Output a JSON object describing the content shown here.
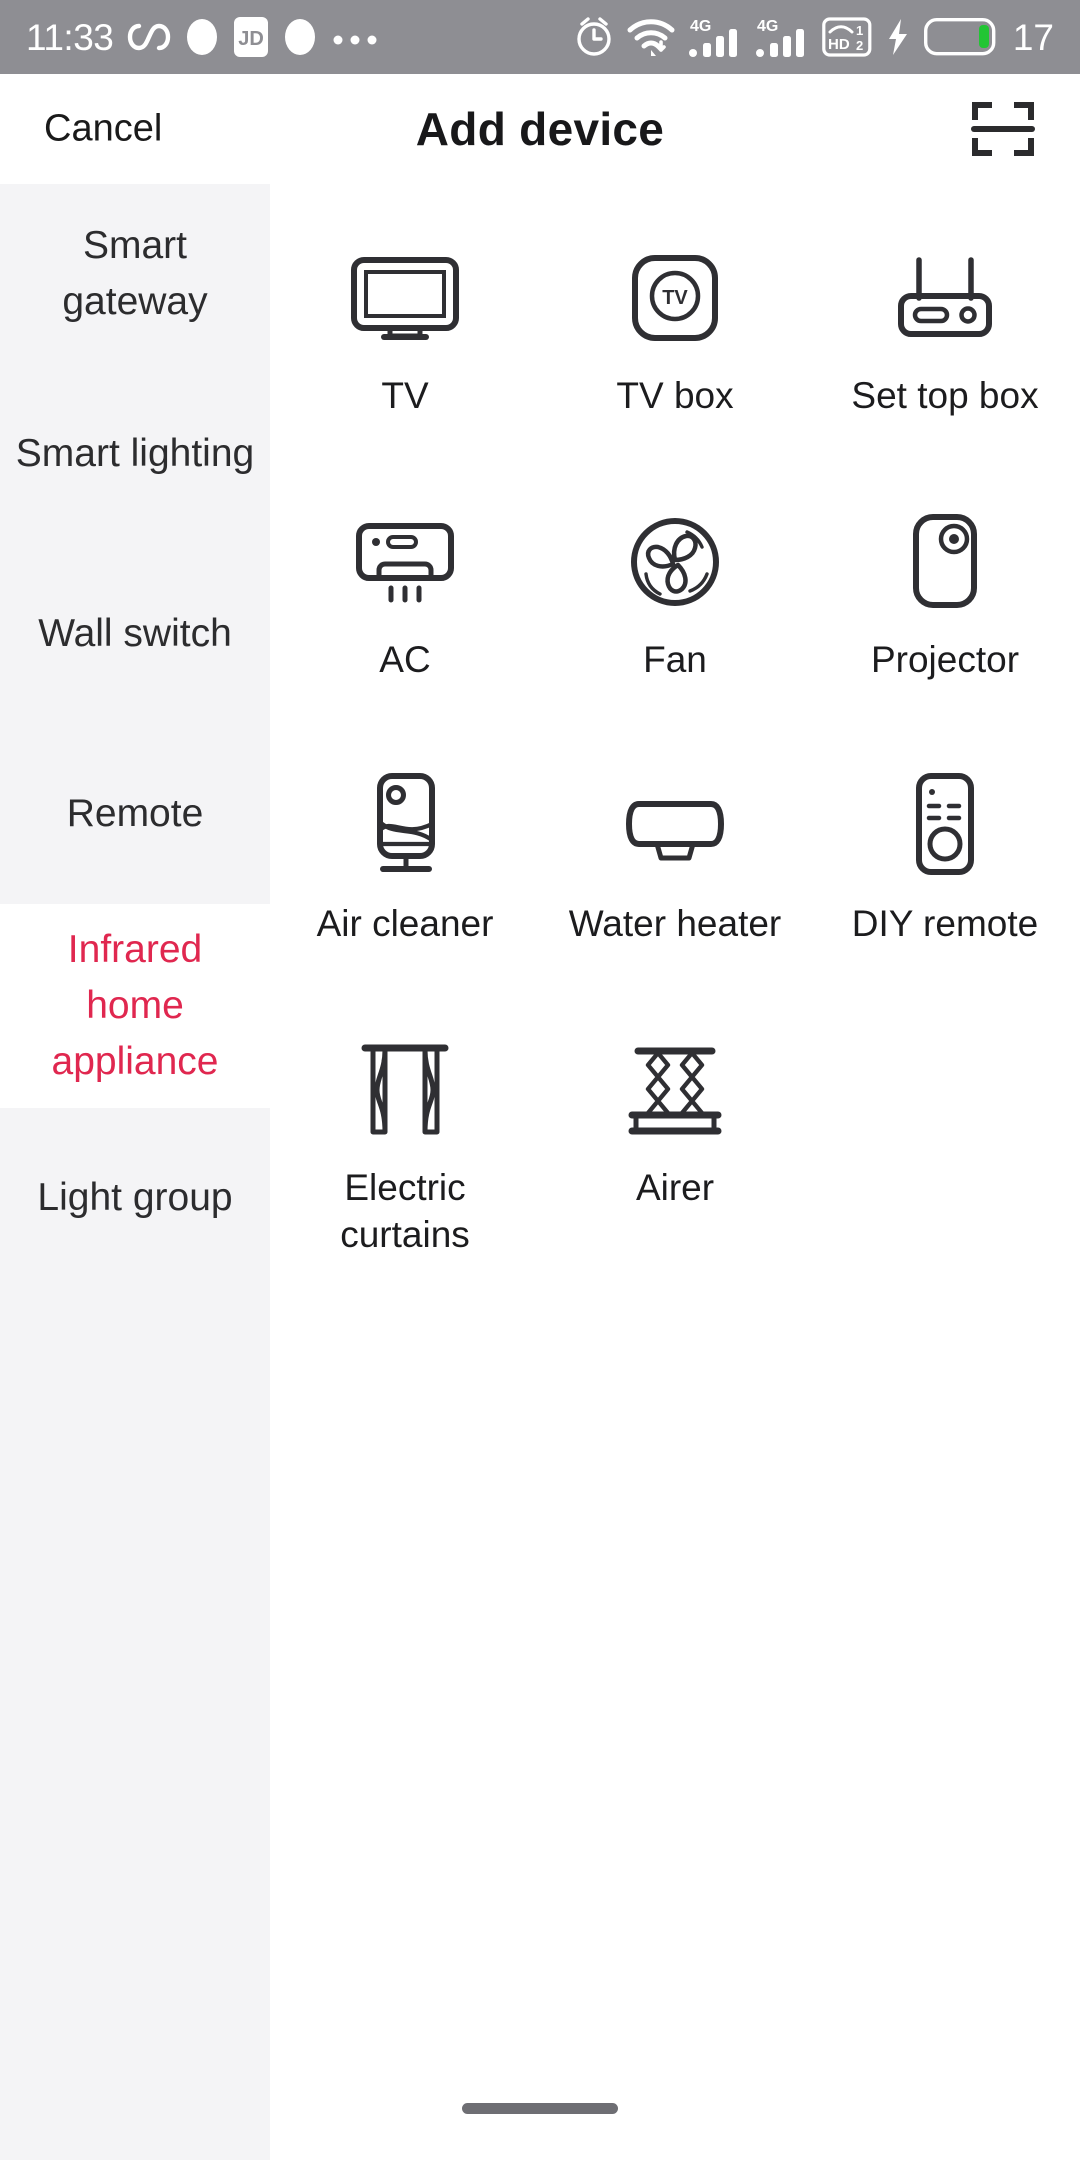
{
  "status_bar": {
    "time": "11:33",
    "battery_level": "17",
    "left_icons": [
      "infinity-icon",
      "oval-app-icon",
      "jd-app-icon",
      "oval-app-icon-2",
      "more-dots-icon"
    ],
    "right_icons": [
      "alarm-clock-icon",
      "wifi-icon",
      "signal-4g-icon-1",
      "signal-4g-icon-2",
      "volte-hd-icon",
      "charging-bolt-icon",
      "battery-icon"
    ],
    "network_label": "4G",
    "hd_label": "HD",
    "sim1_label": "1",
    "sim2_label": "2",
    "background_color": "#8e8e93",
    "foreground_color": "#ffffff",
    "battery_fill_color": "#22c534"
  },
  "header": {
    "cancel_label": "Cancel",
    "title": "Add device",
    "scan_icon": "scan-qr-icon"
  },
  "sidebar": {
    "active_color": "#e0274f",
    "items": [
      {
        "label": "Smart gateway",
        "active": false
      },
      {
        "label": "Smart lighting",
        "active": false
      },
      {
        "label": "Wall switch",
        "active": false
      },
      {
        "label": "Remote",
        "active": false
      },
      {
        "label": "Infrared home appliance",
        "active": true
      },
      {
        "label": "Light group",
        "active": false
      }
    ]
  },
  "devices": [
    {
      "label": "TV",
      "icon": "tv-icon"
    },
    {
      "label": "TV box",
      "icon": "tv-box-icon"
    },
    {
      "label": "Set top box",
      "icon": "set-top-box-icon"
    },
    {
      "label": "AC",
      "icon": "air-conditioner-icon"
    },
    {
      "label": "Fan",
      "icon": "fan-icon"
    },
    {
      "label": "Projector",
      "icon": "projector-icon"
    },
    {
      "label": "Air cleaner",
      "icon": "air-cleaner-icon"
    },
    {
      "label": "Water heater",
      "icon": "water-heater-icon"
    },
    {
      "label": "DIY remote",
      "icon": "diy-remote-icon"
    },
    {
      "label": "Electric curtains",
      "icon": "electric-curtains-icon"
    },
    {
      "label": "Airer",
      "icon": "airer-icon"
    }
  ],
  "navigation": {
    "home_indicator": "home-indicator"
  }
}
